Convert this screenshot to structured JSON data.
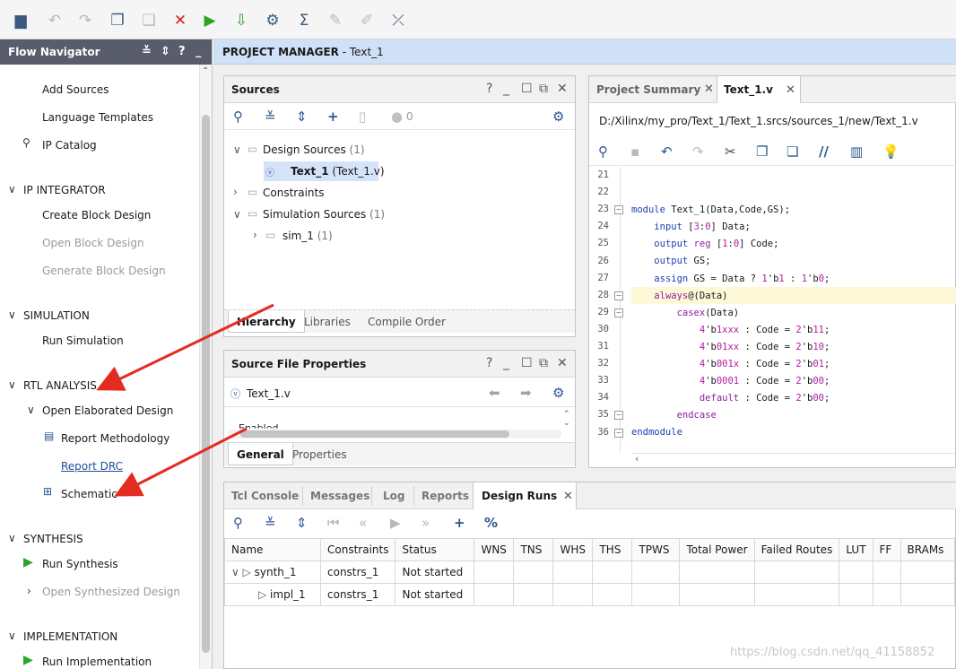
{
  "toolbar": {
    "icons": [
      "open-icon",
      "undo-icon",
      "redo-icon",
      "copy-icon",
      "paste-icon",
      "delete-icon",
      "run-icon",
      "download-icon",
      "settings-icon",
      "sigma-icon",
      "disabled-icon-1",
      "disabled-icon-2",
      "cross-probe-icon"
    ]
  },
  "nav": {
    "title": "Flow Navigator",
    "items": {
      "add_sources": "Add Sources",
      "language_templates": "Language Templates",
      "ip_catalog": "IP Catalog",
      "ip_integrator": "IP INTEGRATOR",
      "create_block_design": "Create Block Design",
      "open_block_design": "Open Block Design",
      "generate_block_design": "Generate Block Design",
      "simulation": "SIMULATION",
      "run_simulation": "Run Simulation",
      "rtl_analysis": "RTL ANALYSIS",
      "open_elaborated_design": "Open Elaborated Design",
      "report_methodology": "Report Methodology",
      "report_drc": "Report DRC",
      "schematic": "Schematic",
      "synthesis": "SYNTHESIS",
      "run_synthesis": "Run Synthesis",
      "open_synthesized_design": "Open Synthesized Design",
      "implementation": "IMPLEMENTATION",
      "run_implementation": "Run Implementation"
    }
  },
  "project_manager": {
    "title": "PROJECT MANAGER",
    "project": " - Text_1"
  },
  "sources": {
    "title": "Sources",
    "badge_count": "0",
    "tree": {
      "design_sources": "Design Sources",
      "design_sources_count": " (1)",
      "file_name": "Text_1",
      "file_detail": " (Text_1.v)",
      "constraints": "Constraints",
      "simulation_sources": "Simulation Sources",
      "simulation_sources_count": " (1)",
      "sim_1": "sim_1",
      "sim_1_count": " (1)"
    },
    "tabs": [
      "Hierarchy",
      "Libraries",
      "Compile Order"
    ]
  },
  "source_props": {
    "title": "Source File Properties",
    "file": "Text_1.v",
    "enabled": "Enabled",
    "tabs": [
      "General",
      "Properties"
    ]
  },
  "editor": {
    "tabs": [
      "Project Summary",
      "Text_1.v"
    ],
    "path": "D:/Xilinx/my_pro/Text_1/Text_1.srcs/sources_1/new/Text_1.v",
    "line_numbers": [
      "21",
      "22",
      "23",
      "24",
      "25",
      "26",
      "27",
      "28",
      "29",
      "30",
      "31",
      "32",
      "33",
      "34",
      "35",
      "36"
    ]
  },
  "bottom": {
    "tabs": [
      "Tcl Console",
      "Messages",
      "Log",
      "Reports",
      "Design Runs"
    ],
    "columns": [
      "Name",
      "Constraints",
      "Status",
      "WNS",
      "TNS",
      "WHS",
      "THS",
      "TPWS",
      "Total Power",
      "Failed Routes",
      "LUT",
      "FF",
      "BRAMs"
    ],
    "rows": [
      {
        "name": "synth_1",
        "constraints": "constrs_1",
        "status": "Not started"
      },
      {
        "name": "impl_1",
        "constraints": "constrs_1",
        "status": "Not started"
      }
    ]
  },
  "watermark": "https://blog.csdn.net/qq_41158852",
  "colors": {
    "accent": "#1f4e9a",
    "run_green": "#2aa52a",
    "delete_red": "#d62020",
    "arrow_red": "#e32b22"
  }
}
